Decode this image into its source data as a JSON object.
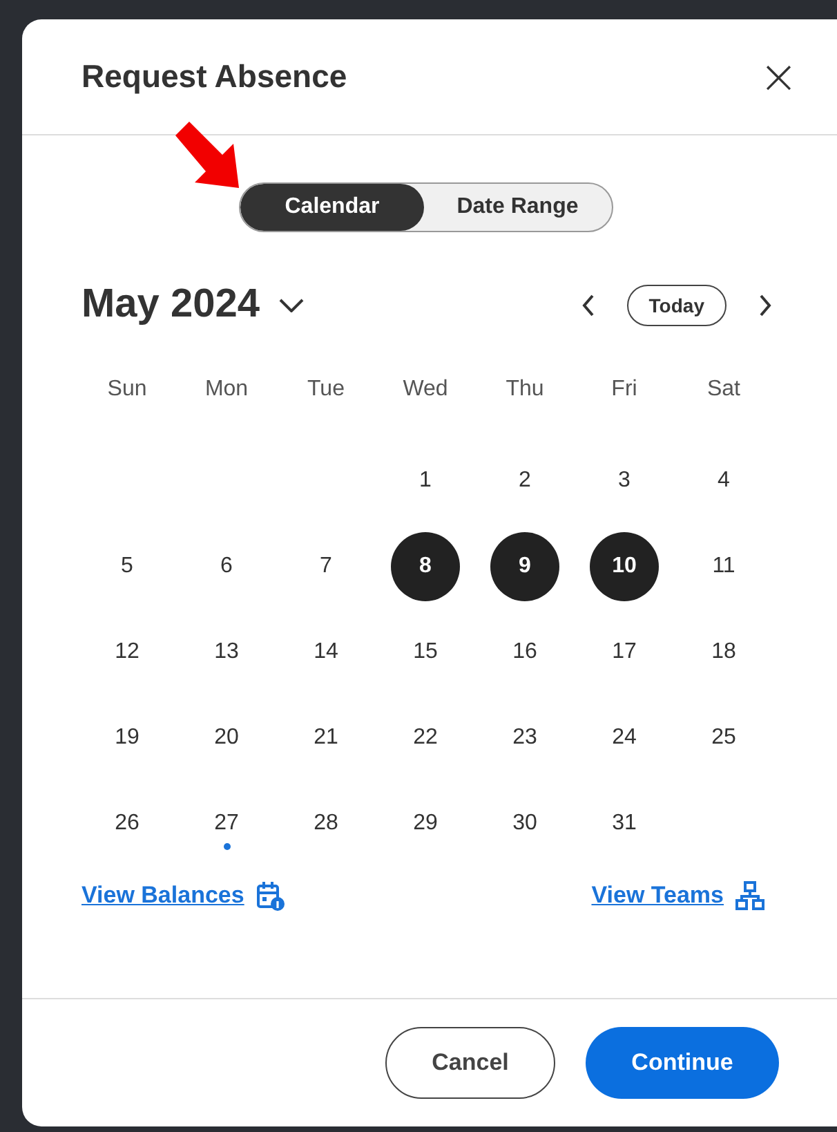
{
  "dialog": {
    "title": "Request Absence",
    "close": "×"
  },
  "annotation": {
    "kind": "arrow"
  },
  "view_toggle": [
    {
      "label": "Calendar",
      "selected": true
    },
    {
      "label": "Date Range",
      "selected": false
    }
  ],
  "calendar": {
    "month": "May 2024",
    "today_button": "Today",
    "weekdays": [
      "Sun",
      "Mon",
      "Tue",
      "Wed",
      "Thu",
      "Fri",
      "Sat"
    ],
    "weeks": [
      {
        "right_aligned": true,
        "days": [
          {
            "day": "1",
            "selected": false,
            "marked": false
          },
          {
            "day": "2",
            "selected": false,
            "marked": false
          },
          {
            "day": "3",
            "selected": false,
            "marked": false
          },
          {
            "day": "4",
            "selected": false,
            "marked": false
          }
        ]
      },
      {
        "days": [
          {
            "day": "5",
            "selected": false,
            "marked": false
          },
          {
            "day": "6",
            "selected": false,
            "marked": false
          },
          {
            "day": "7",
            "selected": false,
            "marked": false
          },
          {
            "day": "8",
            "selected": true,
            "marked": false
          },
          {
            "day": "9",
            "selected": true,
            "marked": false
          },
          {
            "day": "10",
            "selected": true,
            "marked": false
          },
          {
            "day": "11",
            "selected": false,
            "marked": false
          }
        ]
      },
      {
        "days": [
          {
            "day": "12",
            "selected": false,
            "marked": false
          },
          {
            "day": "13",
            "selected": false,
            "marked": false
          },
          {
            "day": "14",
            "selected": false,
            "marked": false
          },
          {
            "day": "15",
            "selected": false,
            "marked": false
          },
          {
            "day": "16",
            "selected": false,
            "marked": false
          },
          {
            "day": "17",
            "selected": false,
            "marked": false
          },
          {
            "day": "18",
            "selected": false,
            "marked": false
          }
        ]
      },
      {
        "days": [
          {
            "day": "19",
            "selected": false,
            "marked": false
          },
          {
            "day": "20",
            "selected": false,
            "marked": false
          },
          {
            "day": "21",
            "selected": false,
            "marked": false
          },
          {
            "day": "22",
            "selected": false,
            "marked": false
          },
          {
            "day": "23",
            "selected": false,
            "marked": false
          },
          {
            "day": "24",
            "selected": false,
            "marked": false
          },
          {
            "day": "25",
            "selected": false,
            "marked": false
          }
        ]
      },
      {
        "right_aligned": false,
        "days": [
          {
            "day": "26",
            "selected": false,
            "marked": false
          },
          {
            "day": "27",
            "selected": false,
            "marked": true
          },
          {
            "day": "28",
            "selected": false,
            "marked": false
          },
          {
            "day": "29",
            "selected": false,
            "marked": false
          },
          {
            "day": "30",
            "selected": false,
            "marked": false
          },
          {
            "day": "31",
            "selected": false,
            "marked": false
          }
        ]
      }
    ]
  },
  "links": [
    {
      "label": "View Balances",
      "kind": "balances"
    },
    {
      "label": "View Teams",
      "kind": "teams"
    }
  ],
  "buttons": [
    {
      "label": "Cancel",
      "kind": "secondary"
    },
    {
      "label": "Continue",
      "kind": "primary"
    }
  ]
}
